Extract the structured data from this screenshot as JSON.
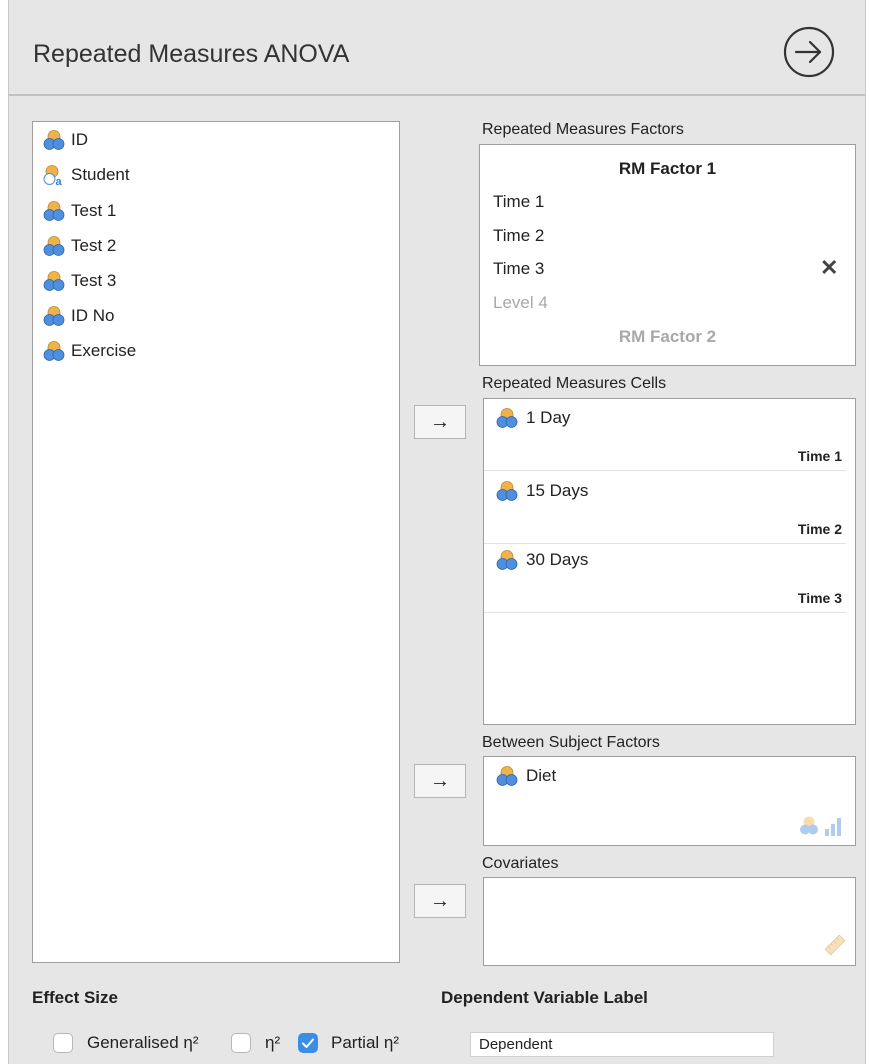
{
  "header": {
    "title": "Repeated Measures ANOVA"
  },
  "variables": [
    {
      "name": "ID",
      "icon": "nominal-icon"
    },
    {
      "name": "Student",
      "icon": "nominal-text-icon"
    },
    {
      "name": "Test 1",
      "icon": "nominal-icon"
    },
    {
      "name": "Test 2",
      "icon": "nominal-icon"
    },
    {
      "name": "Test 3",
      "icon": "nominal-icon"
    },
    {
      "name": "ID No",
      "icon": "nominal-icon"
    },
    {
      "name": "Exercise",
      "icon": "nominal-icon"
    }
  ],
  "rm_factors": {
    "label": "Repeated Measures Factors",
    "factor1_name": "RM Factor 1",
    "levels": [
      "Time 1",
      "Time 2",
      "Time 3"
    ],
    "next_level_placeholder": "Level 4",
    "factor2_placeholder": "RM Factor 2"
  },
  "rm_cells": {
    "label": "Repeated Measures Cells",
    "cells": [
      {
        "variable": "1 Day",
        "level": "Time 1"
      },
      {
        "variable": "15 Days",
        "level": "Time 2"
      },
      {
        "variable": "30 Days",
        "level": "Time 3"
      }
    ]
  },
  "between": {
    "label": "Between Subject Factors",
    "items": [
      "Diet"
    ]
  },
  "covariates": {
    "label": "Covariates"
  },
  "effect_size": {
    "label": "Effect Size",
    "options": [
      {
        "label": "Generalised η²",
        "checked": false
      },
      {
        "label": "η²",
        "checked": false
      },
      {
        "label": "Partial η²",
        "checked": true
      }
    ]
  },
  "dependent_label": {
    "label": "Dependent Variable Label",
    "value": "Dependent"
  },
  "colors": {
    "accent": "#3b8ee6",
    "icon_orange": "#f0b24a",
    "icon_blue": "#4f8fde"
  }
}
